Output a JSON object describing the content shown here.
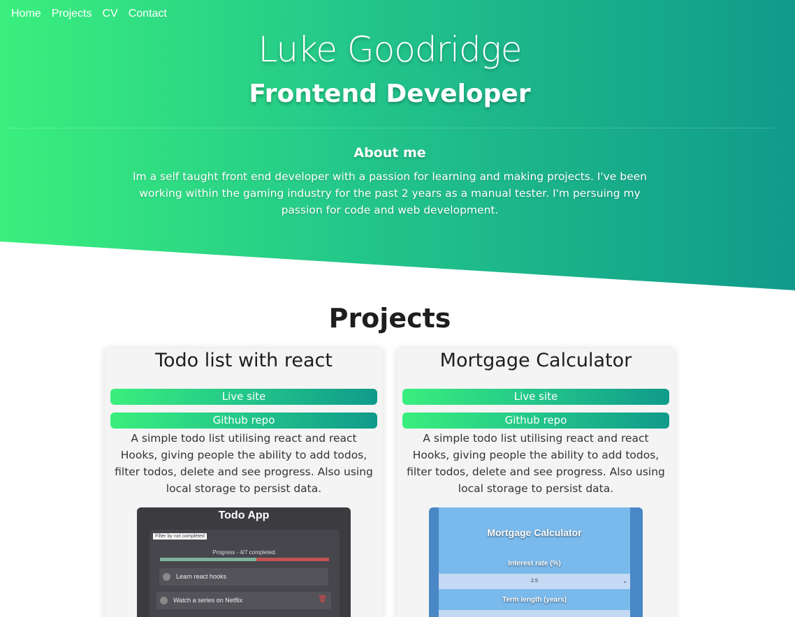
{
  "nav": {
    "items": [
      "Home",
      "Projects",
      "CV",
      "Contact"
    ]
  },
  "hero": {
    "name": "Luke Goodridge",
    "role": "Frontend Developer",
    "about_title": "About me",
    "about_text": "Im a self taught front end developer with a passion for learning and making projects. I've been working within the gaming industry for the past 2 years as a manual tester. I'm persuing my passion for code and web development."
  },
  "projects": {
    "title": "Projects",
    "cards": [
      {
        "title": "Todo list with react",
        "live_label": "Live site",
        "repo_label": "Github repo",
        "description": "A simple todo list utilising react and react Hooks, giving people the ability to add todos, filter todos, delete and see progress. Also using local storage to persist data.",
        "screenshot": {
          "app_title": "Todo App",
          "filter_label": "Filter by not completed",
          "progress_label": "Progress - 4/7 completed.",
          "progress_fraction": 0.571,
          "items": [
            "Learn react hooks",
            "Watch a series on Netflix"
          ]
        }
      },
      {
        "title": "Mortgage Calculator",
        "live_label": "Live site",
        "repo_label": "Github repo",
        "description": "A simple todo list utilising react and react Hooks, giving people the ability to add todos, filter todos, delete and see progress. Also using local storage to persist data.",
        "screenshot": {
          "app_title": "Mortgage Calculator",
          "interest_label": "Interest rate (%)",
          "interest_value": "2.5",
          "term_label": "Term length (years)"
        }
      }
    ]
  },
  "colors": {
    "gradient_start": "#3aef7d",
    "gradient_end": "#109a8b"
  }
}
